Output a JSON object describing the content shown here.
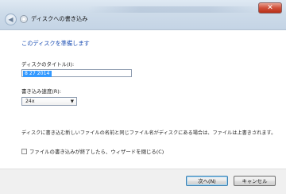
{
  "window": {
    "title": "ディスクへの書き込み",
    "close_label": "✕",
    "back_label": "◀"
  },
  "main": {
    "heading": "このディスクを準備します",
    "disc_title_label": "ディスクのタイトル(I):",
    "disc_title_value": "8 27 2014",
    "speed_label": "書き込み速度(R):",
    "speed_value": "24x",
    "speed_arrow": "▼",
    "notice": "ディスクに書き込む新しいファイルの名前と同じファイル名がディスクにある場合は、ファイルは上書きされます。",
    "close_wizard_label": "ファイルの書き込みが終了したら、ウィザードを閉じる(C)",
    "close_wizard_checked": false
  },
  "footer": {
    "next_label": "次へ(N)",
    "cancel_label": "キャンセル"
  }
}
